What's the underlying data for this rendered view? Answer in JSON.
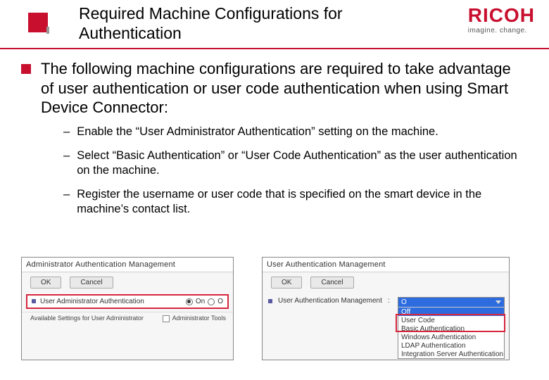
{
  "brand": {
    "name": "RICOH",
    "tagline": "imagine. change.",
    "accent": "#c8102e"
  },
  "title": "Required Machine Configurations for Authentication",
  "intro": "The following machine configurations are required to take advantage of user authentication or user code authentication when using Smart Device Connector:",
  "steps": [
    "Enable the “User Administrator Authentication” setting on the machine.",
    "Select “Basic Authentication” or “User Code Authentication” as the user authentication on the machine.",
    "Register the username or user code that is specified on the smart device in the machine’s contact list."
  ],
  "panelA": {
    "title": "Administrator Authentication Management",
    "ok": "OK",
    "cancel": "Cancel",
    "row_label": "User Administrator Authentication",
    "radio_on": "On",
    "radio_off": "O",
    "footer_left": "Available Settings for User Administrator",
    "footer_right": "Administrator Tools"
  },
  "panelB": {
    "title": "User Authentication Management",
    "ok": "OK",
    "cancel": "Cancel",
    "row_label": "User Authentication Management",
    "selected": "O",
    "options": [
      "Off",
      "User Code",
      "Basic Authentication",
      "Windows Authentication",
      "LDAP Authentication",
      "Integration Server Authentication"
    ]
  }
}
